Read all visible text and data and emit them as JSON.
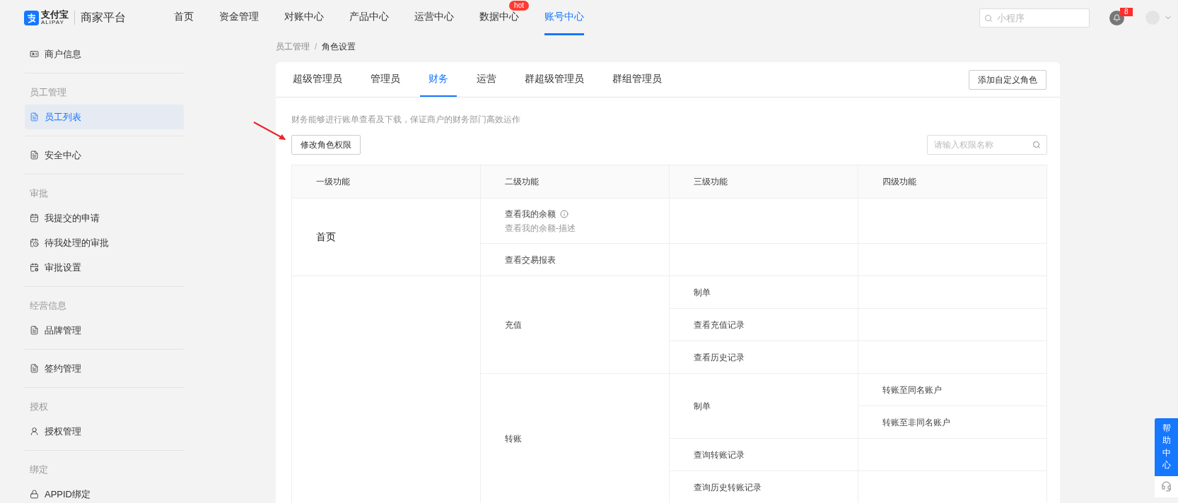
{
  "header": {
    "logo_mark": "支付宝",
    "logo_sub": "ALIPAY",
    "platform": "商家平台",
    "nav": [
      {
        "label": "首页",
        "selected": false
      },
      {
        "label": "资金管理",
        "selected": false
      },
      {
        "label": "对账中心",
        "selected": false
      },
      {
        "label": "产品中心",
        "selected": false
      },
      {
        "label": "运营中心",
        "selected": false
      },
      {
        "label": "数据中心",
        "selected": false,
        "badge": "hot"
      },
      {
        "label": "账号中心",
        "selected": true
      }
    ],
    "search": {
      "placeholder": "小程序"
    },
    "notifications": "8"
  },
  "sidebar": {
    "sections": [
      {
        "items": [
          {
            "label": "商户信息",
            "kind": "idcard",
            "selected": false
          }
        ]
      },
      {
        "title": "员工管理",
        "items": [
          {
            "label": "员工列表",
            "kind": "doc",
            "selected": true
          }
        ]
      },
      {
        "items": [
          {
            "label": "安全中心",
            "kind": "doc",
            "selected": false
          }
        ]
      },
      {
        "title": "审批",
        "items": [
          {
            "label": "我提交的申请",
            "kind": "check",
            "selected": false
          },
          {
            "label": "待我处理的审批",
            "kind": "pending",
            "selected": false
          },
          {
            "label": "审批设置",
            "kind": "settings",
            "selected": false
          }
        ]
      },
      {
        "title": "经营信息",
        "items": [
          {
            "label": "品牌管理",
            "kind": "doc",
            "selected": false
          }
        ]
      },
      {
        "items": [
          {
            "label": "签约管理",
            "kind": "doc",
            "selected": false
          }
        ]
      },
      {
        "title": "授权",
        "items": [
          {
            "label": "授权管理",
            "kind": "user",
            "selected": false
          }
        ]
      },
      {
        "title": "绑定",
        "items": [
          {
            "label": "APPID绑定",
            "kind": "lock",
            "selected": false
          }
        ]
      }
    ]
  },
  "breadcrumb": [
    "员工管理",
    "/",
    "角色设置"
  ],
  "tabs": [
    {
      "label": "超级管理员",
      "selected": false
    },
    {
      "label": "管理员",
      "selected": false
    },
    {
      "label": "财务",
      "selected": true
    },
    {
      "label": "运营",
      "selected": false
    },
    {
      "label": "群超级管理员",
      "selected": false
    },
    {
      "label": "群组管理员",
      "selected": false
    }
  ],
  "add_role_button": "添加自定义角色",
  "description": "财务能够进行账单查看及下载，保证商户的财务部门高效运作",
  "edit_button": "修改角色权限",
  "permission_search": {
    "placeholder": "请输入权限名称"
  },
  "table": {
    "columns": [
      "一级功能",
      "二级功能",
      "三级功能",
      "四级功能"
    ],
    "rows": [
      {
        "label": "首页",
        "children": [
          {
            "label": "查看我的余额",
            "info_icon": true,
            "description": "查看我的余额-描述"
          },
          {
            "label": "查看交易报表"
          }
        ]
      },
      {
        "children": [
          {
            "label": "充值",
            "children": [
              {
                "label": "制单"
              },
              {
                "label": "查看充值记录"
              },
              {
                "label": "查看历史记录"
              }
            ]
          },
          {
            "label": "转账",
            "children": [
              {
                "label": "制单",
                "children": [
                  {
                    "label": "转账至同名账户"
                  },
                  {
                    "label": "转账至非同名账户"
                  }
                ]
              },
              {
                "label": "查询转账记录"
              },
              {
                "label": "查询历史转账记录"
              }
            ]
          }
        ]
      }
    ]
  },
  "help": {
    "label": "帮助中心"
  }
}
